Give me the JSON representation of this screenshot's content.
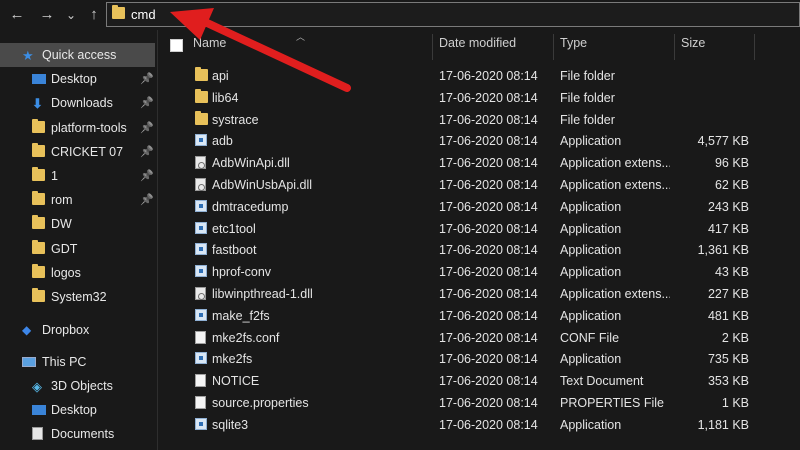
{
  "address_bar": {
    "path": "cmd"
  },
  "nav": {
    "back": "←",
    "forward": "→",
    "recent": "⌄",
    "up": "↑"
  },
  "sidebar": {
    "items": [
      {
        "label": "Quick access",
        "icon": "star-icon",
        "pinned": false,
        "selected": true
      },
      {
        "label": "Desktop",
        "icon": "desktop-icon",
        "pinned": true
      },
      {
        "label": "Downloads",
        "icon": "download-icon",
        "pinned": true
      },
      {
        "label": "platform-tools",
        "icon": "folder-icon",
        "pinned": true
      },
      {
        "label": "CRICKET 07",
        "icon": "folder-icon",
        "pinned": true
      },
      {
        "label": "1",
        "icon": "folder-icon",
        "pinned": true
      },
      {
        "label": "rom",
        "icon": "folder-icon",
        "pinned": true
      },
      {
        "label": "DW",
        "icon": "folder-icon",
        "pinned": false
      },
      {
        "label": "GDT",
        "icon": "folder-icon",
        "pinned": false
      },
      {
        "label": "logos",
        "icon": "folder-icon",
        "pinned": false
      },
      {
        "label": "System32",
        "icon": "folder-icon",
        "pinned": false
      },
      {
        "label": "Dropbox",
        "icon": "dropbox-icon",
        "pinned": false
      },
      {
        "label": "This PC",
        "icon": "computer-icon",
        "pinned": false
      },
      {
        "label": "3D Objects",
        "icon": "cube-icon",
        "pinned": false
      },
      {
        "label": "Desktop",
        "icon": "desktop-icon",
        "pinned": false
      },
      {
        "label": "Documents",
        "icon": "documents-icon",
        "pinned": false
      }
    ]
  },
  "columns": {
    "name": "Name",
    "date": "Date modified",
    "type": "Type",
    "size": "Size"
  },
  "files": [
    {
      "name": "api",
      "date": "17-06-2020 08:14",
      "type": "File folder",
      "size": "",
      "icon": "folder-icon"
    },
    {
      "name": "lib64",
      "date": "17-06-2020 08:14",
      "type": "File folder",
      "size": "",
      "icon": "folder-icon"
    },
    {
      "name": "systrace",
      "date": "17-06-2020 08:14",
      "type": "File folder",
      "size": "",
      "icon": "folder-icon"
    },
    {
      "name": "adb",
      "date": "17-06-2020 08:14",
      "type": "Application",
      "size": "4,577 KB",
      "icon": "application-icon"
    },
    {
      "name": "AdbWinApi.dll",
      "date": "17-06-2020 08:14",
      "type": "Application extens...",
      "size": "96 KB",
      "icon": "dll-icon"
    },
    {
      "name": "AdbWinUsbApi.dll",
      "date": "17-06-2020 08:14",
      "type": "Application extens...",
      "size": "62 KB",
      "icon": "dll-icon"
    },
    {
      "name": "dmtracedump",
      "date": "17-06-2020 08:14",
      "type": "Application",
      "size": "243 KB",
      "icon": "application-icon"
    },
    {
      "name": "etc1tool",
      "date": "17-06-2020 08:14",
      "type": "Application",
      "size": "417 KB",
      "icon": "application-icon"
    },
    {
      "name": "fastboot",
      "date": "17-06-2020 08:14",
      "type": "Application",
      "size": "1,361 KB",
      "icon": "application-icon"
    },
    {
      "name": "hprof-conv",
      "date": "17-06-2020 08:14",
      "type": "Application",
      "size": "43 KB",
      "icon": "application-icon"
    },
    {
      "name": "libwinpthread-1.dll",
      "date": "17-06-2020 08:14",
      "type": "Application extens...",
      "size": "227 KB",
      "icon": "dll-icon"
    },
    {
      "name": "make_f2fs",
      "date": "17-06-2020 08:14",
      "type": "Application",
      "size": "481 KB",
      "icon": "application-icon"
    },
    {
      "name": "mke2fs.conf",
      "date": "17-06-2020 08:14",
      "type": "CONF File",
      "size": "2 KB",
      "icon": "document-icon"
    },
    {
      "name": "mke2fs",
      "date": "17-06-2020 08:14",
      "type": "Application",
      "size": "735 KB",
      "icon": "application-icon"
    },
    {
      "name": "NOTICE",
      "date": "17-06-2020 08:14",
      "type": "Text Document",
      "size": "353 KB",
      "icon": "document-icon"
    },
    {
      "name": "source.properties",
      "date": "17-06-2020 08:14",
      "type": "PROPERTIES File",
      "size": "1 KB",
      "icon": "document-icon"
    },
    {
      "name": "sqlite3",
      "date": "17-06-2020 08:14",
      "type": "Application",
      "size": "1,181 KB",
      "icon": "application-icon"
    }
  ],
  "colors": {
    "background": "#191919",
    "selected": "#4a4a4a",
    "folder": "#e8c15a",
    "annotation_arrow": "#e01e1e"
  }
}
